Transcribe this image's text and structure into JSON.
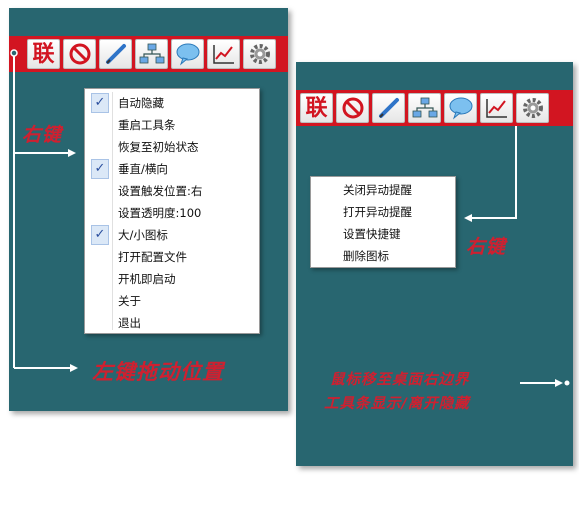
{
  "toolbar_icons": [
    "lian-logo-icon",
    "block-icon",
    "pen-icon",
    "network-icon",
    "chat-bubble-icon",
    "chart-icon",
    "gear-icon"
  ],
  "toolbar": {
    "logo_text": "联"
  },
  "left_menu": {
    "items": [
      {
        "label": "自动隐藏",
        "checked": true
      },
      {
        "label": "重启工具条",
        "checked": false
      },
      {
        "label": "恢复至初始状态",
        "checked": false
      },
      {
        "label": "垂直/横向",
        "checked": true
      },
      {
        "label": "设置触发位置:右",
        "checked": false
      },
      {
        "label": "设置透明度:100",
        "checked": false
      },
      {
        "label": "大/小图标",
        "checked": true
      },
      {
        "label": "打开配置文件",
        "checked": false
      },
      {
        "label": "开机即启动",
        "checked": false
      },
      {
        "label": "关于",
        "checked": false
      },
      {
        "label": "退出",
        "checked": false
      }
    ]
  },
  "right_menu": {
    "items": [
      {
        "label": "关闭异动提醒"
      },
      {
        "label": "打开异动提醒"
      },
      {
        "label": "设置快捷键"
      },
      {
        "label": "删除图标"
      }
    ]
  },
  "annotations": {
    "left_right_click": "右键",
    "left_drag": "左键拖动位置",
    "right_right_click": "右键",
    "edge_line1": "鼠标移至桌面右边界",
    "edge_line2": "工具条显示/离开隐藏"
  },
  "colors": {
    "panel_bg": "#286670",
    "toolbar_red": "#d21521",
    "annotation_red": "#cf2030",
    "check_blue": "#2b4f9e"
  }
}
